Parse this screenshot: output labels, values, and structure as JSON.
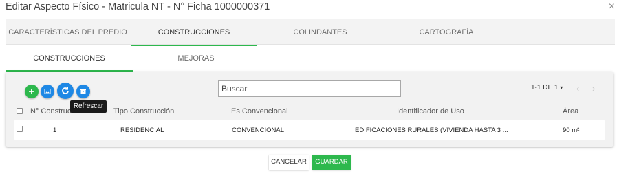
{
  "dialog": {
    "title": "Editar Aspecto Físico - Matricula NT - N° Ficha 1000000371",
    "close_glyph": "×"
  },
  "main_tabs": [
    {
      "label": "CARACTERÍSTICAS DEL PREDIO",
      "active": false
    },
    {
      "label": "CONSTRUCCIONES",
      "active": true
    },
    {
      "label": "COLINDANTES",
      "active": false
    },
    {
      "label": "CARTOGRAFÍA",
      "active": false
    }
  ],
  "sub_tabs": [
    {
      "label": "CONSTRUCCIONES",
      "active": true
    },
    {
      "label": "MEJORAS",
      "active": false
    }
  ],
  "toolbar": {
    "buttons": [
      {
        "icon": "plus-icon",
        "color": "#2db84d"
      },
      {
        "icon": "image-icon",
        "color": "#1e88e5"
      },
      {
        "icon": "refresh-icon",
        "color": "#1e88e5"
      },
      {
        "icon": "archive-icon",
        "color": "#1e88e5"
      }
    ],
    "tooltip": "Refrescar"
  },
  "search": {
    "placeholder": "Buscar",
    "value": ""
  },
  "pagination": {
    "label": "1-1 DE 1",
    "caret": "▾",
    "prev": "‹",
    "next": "›"
  },
  "table": {
    "columns": [
      "N° Construcción",
      "Tipo Construcción",
      "Es Convencional",
      "Identificador de Uso",
      "Área"
    ],
    "rows": [
      {
        "n": "1",
        "tipo": "RESIDENCIAL",
        "convencional": "CONVENCIONAL",
        "uso": "EDIFICACIONES RURALES (VIVIENDA HASTA 3 ...",
        "area": "90 m²"
      }
    ]
  },
  "footer": {
    "cancel_label": "CANCELAR",
    "save_label": "GUARDAR"
  },
  "colors": {
    "accent_green": "#2db84d",
    "accent_blue": "#1e88e5"
  }
}
